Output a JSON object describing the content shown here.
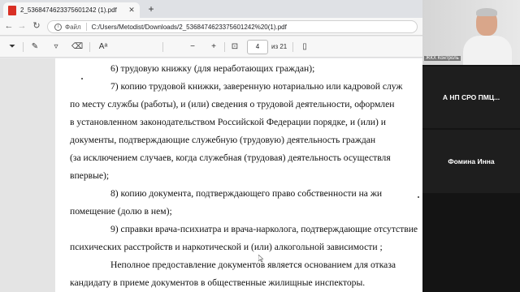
{
  "browser": {
    "tab": {
      "title": "2_5368474623375601242 (1).pdf",
      "close": "✕"
    },
    "new_tab": "+",
    "nav": {
      "back": "←",
      "forward": "→",
      "reload": "↻"
    },
    "address": {
      "scheme_label": "Файл",
      "url": "C:/Users/Metodist/Downloads/2_5368474623375601242%20(1).pdf"
    }
  },
  "pdf_toolbar": {
    "tools": [
      {
        "name": "filter-icon",
        "glyph": "⏷"
      },
      {
        "name": "draw-icon",
        "glyph": "✎"
      },
      {
        "name": "highlight-icon",
        "glyph": "▿"
      },
      {
        "name": "erase-icon",
        "glyph": "⌫"
      },
      {
        "name": "read-aloud-icon",
        "glyph": "Aᵃ"
      },
      {
        "name": "zoom-out-icon",
        "glyph": "−"
      },
      {
        "name": "zoom-in-icon",
        "glyph": "+"
      },
      {
        "name": "fit-page-icon",
        "glyph": "⊡"
      },
      {
        "name": "page-view-icon",
        "glyph": "▯"
      }
    ],
    "page_current": "4",
    "page_total": "из 21"
  },
  "document": {
    "lines": [
      "6) трудовую книжку (для неработающих граждан);",
      "7) копию трудовой книжки, заверенную нотариально или кадровой служ",
      "по месту службы (работы), и (или) сведения о трудовой деятельности, оформлен",
      "в установленном законодательством Российской Федерации порядке, и (или) и",
      "документы, подтверждающие служебную (трудовую) деятельность граждан",
      "(за исключением случаев, когда служебная (трудовая) деятельность осуществля",
      "впервые);",
      "8) копию документа, подтверждающего право собственности на жи",
      "помещение (долю в нем);",
      "9) справки врача-психиатра и врача-нарколога, подтверждающие отсутствие",
      "психических расстройств и наркотической и (или) алкогольной зависимости ;",
      "Неполное предоставление документов является основанием для отказа",
      "кандидату в приеме документов в общественные жилищные инспекторы."
    ]
  },
  "video": {
    "camera_label": "ЖКХ Контроль",
    "participants": [
      "А НП СРО ПМЦ...",
      "Фомина Инна"
    ]
  },
  "colors": {
    "pdf_red": "#d93025",
    "tile_bg": "#1e1e1e"
  }
}
